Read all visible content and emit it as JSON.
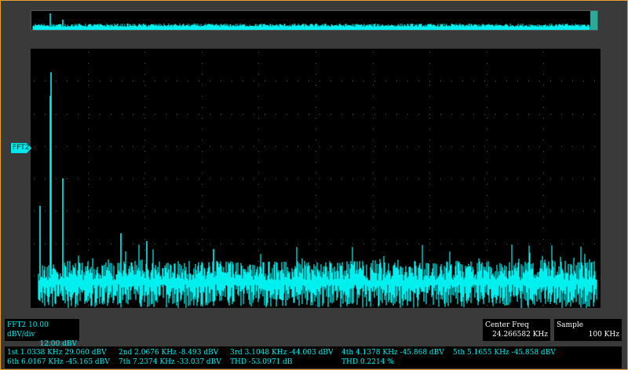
{
  "marker": {
    "label": "FFT2"
  },
  "fft_info": {
    "scale": "FFT2  10.00 dBV/div",
    "offset": "12.00 dBV"
  },
  "center_freq": {
    "label": "Center Freq",
    "value": "24.266582 KHz"
  },
  "sample": {
    "label": "Sample",
    "value": "100 KHz"
  },
  "measurements": {
    "row1": [
      "1st 1.0338 KHz  29.060 dBV",
      "2nd 2.0676 KHz  -8.493 dBV",
      "3rd 3.1048 KHz  -44.003 dBV",
      "4th 4.1378 KHz  -45.868 dBV",
      "5th 5.1655 KHz  -45.858 dBV"
    ],
    "row2": [
      "6th 6.0167 KHz  -45.165 dBV",
      "7th 7.2374 KHz  -33.037 dBV",
      "THD  -53.0971 dB",
      "THD  0.2214 %"
    ]
  },
  "colors": {
    "trace": "#00f0f0",
    "border": "#e8a030",
    "grid": "#5a5a5a"
  }
}
